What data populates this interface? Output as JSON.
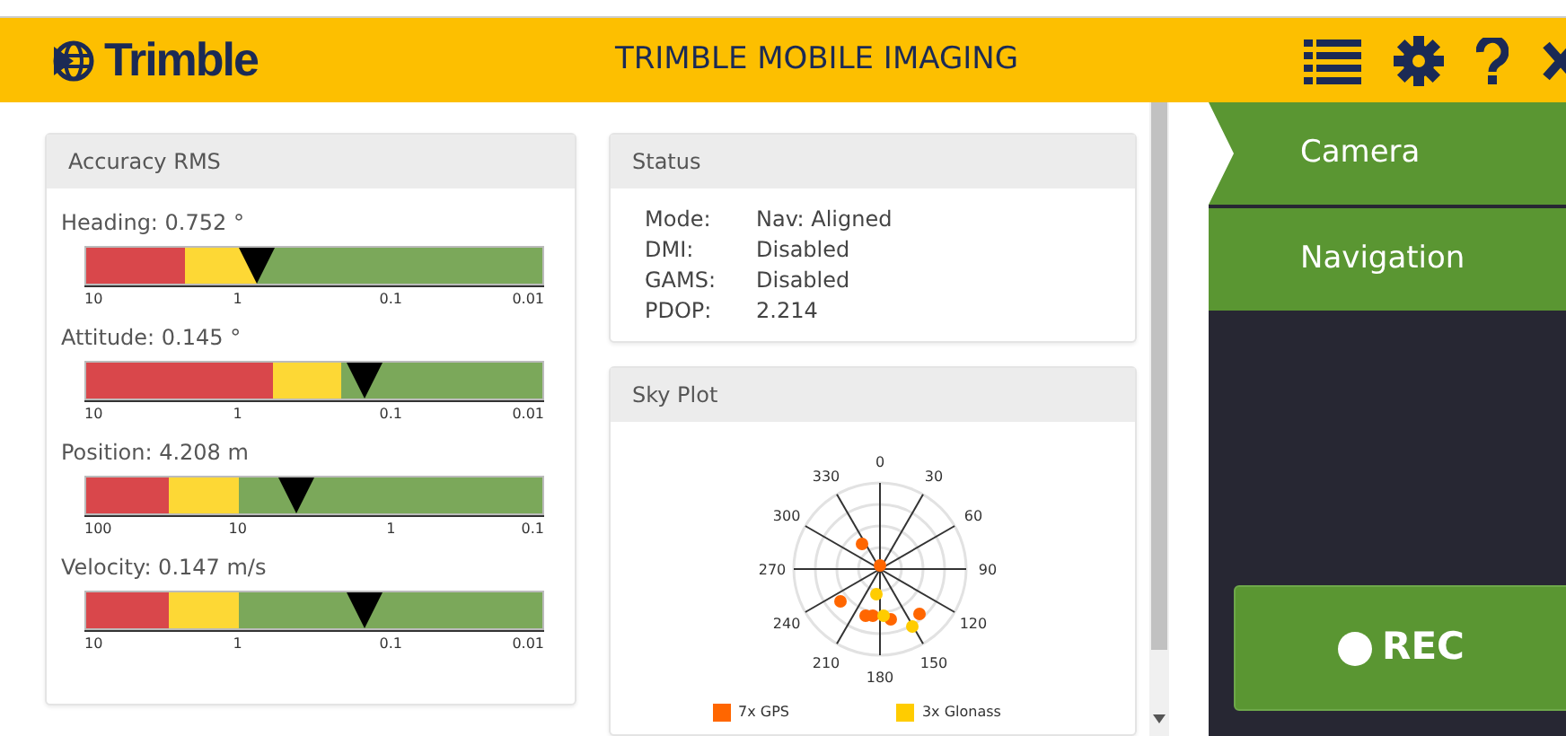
{
  "header": {
    "logo": "Trimble",
    "title": "TRIMBLE MOBILE IMAGING"
  },
  "accuracy": {
    "title": "Accuracy RMS",
    "meters": [
      {
        "label": "Heading: 0.752 °",
        "level": 0.375,
        "zones": [
          {
            "color": "#d9474b",
            "level": 0.215
          },
          {
            "color": "#fdd835",
            "level": 0.375
          },
          {
            "color": "#7ba85a",
            "level": 1
          }
        ],
        "ticks": [
          "10",
          "1",
          "0.1",
          "0.01"
        ]
      },
      {
        "label": "Attitude: 0.145 °",
        "level": 0.61,
        "zones": [
          {
            "color": "#d9474b",
            "level": 0.41
          },
          {
            "color": "#fdd835",
            "level": 0.56
          },
          {
            "color": "#7ba85a",
            "level": 1
          }
        ],
        "ticks": [
          "10",
          "1",
          "0.1",
          "0.01"
        ]
      },
      {
        "label": "Position: 4.208 m",
        "level": 0.46,
        "zones": [
          {
            "color": "#d9474b",
            "level": 0.18
          },
          {
            "color": "#fdd835",
            "level": 0.335
          },
          {
            "color": "#7ba85a",
            "level": 1
          }
        ],
        "ticks": [
          "100",
          "10",
          "1",
          "0.1"
        ]
      },
      {
        "label": "Velocity: 0.147 m/s",
        "level": 0.61,
        "zones": [
          {
            "color": "#d9474b",
            "level": 0.18
          },
          {
            "color": "#fdd835",
            "level": 0.335
          },
          {
            "color": "#7ba85a",
            "level": 1
          }
        ],
        "ticks": [
          "10",
          "1",
          "0.1",
          "0.01"
        ]
      }
    ]
  },
  "status": {
    "title": "Status",
    "rows": [
      {
        "key": "Mode:",
        "value": "Nav: Aligned"
      },
      {
        "key": "DMI:",
        "value": "Disabled"
      },
      {
        "key": "GAMS:",
        "value": "Disabled"
      },
      {
        "key": "PDOP:",
        "value": "2.214"
      }
    ]
  },
  "sky_plot": {
    "title": "Sky Plot",
    "azimuth_labels": [
      "0",
      "30",
      "60",
      "90",
      "120",
      "150",
      "180",
      "210",
      "240",
      "270",
      "300",
      "330"
    ],
    "legend": [
      {
        "label": "7x GPS",
        "color": "#ff6600"
      },
      {
        "label": "3x Glonass",
        "color": "#ffcc00"
      }
    ]
  },
  "sidebar": {
    "tabs": [
      {
        "label": "Camera",
        "selected": true
      },
      {
        "label": "Navigation",
        "selected": false
      }
    ],
    "record_button": "REC"
  }
}
